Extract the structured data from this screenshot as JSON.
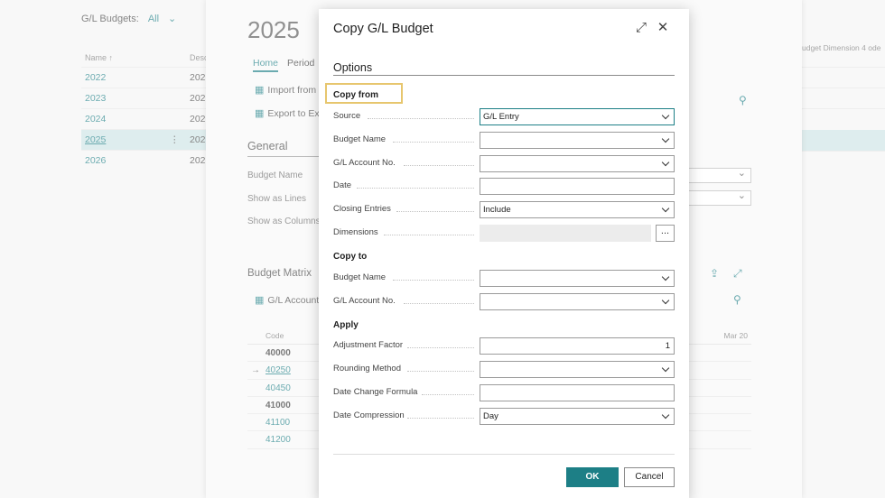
{
  "background": {
    "list_title": "G/L Budgets:",
    "filter": "All",
    "columns": {
      "name": "Name ↑",
      "desc": "Desc"
    },
    "rows": [
      {
        "name": "2022",
        "desc": "202"
      },
      {
        "name": "2023",
        "desc": "202"
      },
      {
        "name": "2024",
        "desc": "202"
      },
      {
        "name": "2025",
        "desc": "202"
      },
      {
        "name": "2026",
        "desc": "202"
      }
    ],
    "right_header": "udget Dimension 4 ode"
  },
  "card": {
    "year": "2025",
    "tabs": [
      "Home",
      "Period"
    ],
    "actions": [
      "Import from E",
      "Export to Exce"
    ],
    "general": "General",
    "fields": [
      "Budget Name",
      "Show as Lines",
      "Show as Columns"
    ],
    "matrix_title": "Budget Matrix",
    "matrix_action": "G/L Account I",
    "matrix_code_header": "Code",
    "matrix_col": "Mar 20",
    "matrix_rows": [
      "40000",
      "40250",
      "40450",
      "41000",
      "41100",
      "41200"
    ]
  },
  "dialog": {
    "title": "Copy G/L Budget",
    "options_heading": "Options",
    "copy_from": {
      "heading": "Copy from",
      "source_label": "Source",
      "source_value": "G/L Entry",
      "budget_name_label": "Budget Name",
      "budget_name_value": "",
      "gl_account_label": "G/L Account No.",
      "gl_account_value": "",
      "date_label": "Date",
      "date_value": "",
      "closing_label": "Closing Entries",
      "closing_value": "Include",
      "dimensions_label": "Dimensions",
      "dimensions_value": "",
      "ellipsis": "..."
    },
    "copy_to": {
      "heading": "Copy to",
      "budget_name_label": "Budget Name",
      "budget_name_value": "",
      "gl_account_label": "G/L Account No.",
      "gl_account_value": ""
    },
    "apply": {
      "heading": "Apply",
      "adjustment_label": "Adjustment Factor",
      "adjustment_value": "1",
      "rounding_label": "Rounding Method",
      "rounding_value": "",
      "date_change_label": "Date Change Formula",
      "date_change_value": "",
      "compression_label": "Date Compression",
      "compression_value": "Day"
    },
    "ok_label": "OK",
    "cancel_label": "Cancel",
    "accent_color": "#1d7f86",
    "focus_color": "#e7c66e"
  }
}
